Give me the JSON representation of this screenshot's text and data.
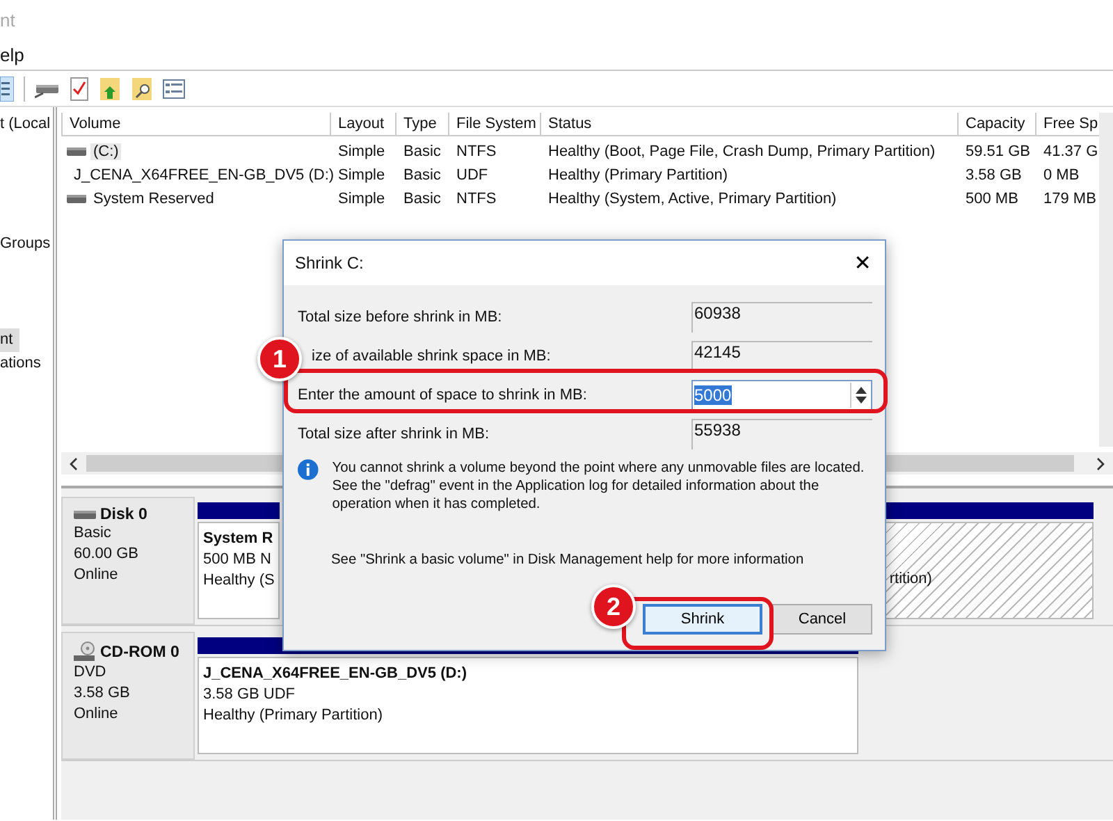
{
  "window": {
    "title": "nt"
  },
  "menu": [
    "elp"
  ],
  "tree": [
    {
      "label": "t (Local",
      "selected": false
    },
    {
      "label": "Groups",
      "selected": false
    },
    {
      "label": "nt",
      "selected": true
    },
    {
      "label": "ations",
      "selected": false
    }
  ],
  "volumes": {
    "columns": [
      "Volume",
      "Layout",
      "Type",
      "File System",
      "Status",
      "Capacity",
      "Free Sp"
    ],
    "rows": [
      {
        "kind": "disk",
        "selected": true,
        "cells": [
          "(C:)",
          "Simple",
          "Basic",
          "NTFS",
          "Healthy (Boot, Page File, Crash Dump, Primary Partition)",
          "59.51 GB",
          "41.37 G"
        ]
      },
      {
        "kind": "cdrom",
        "selected": false,
        "cells": [
          "J_CENA_X64FREE_EN-GB_DV5 (D:)",
          "Simple",
          "Basic",
          "UDF",
          "Healthy (Primary Partition)",
          "3.58 GB",
          "0 MB"
        ]
      },
      {
        "kind": "disk",
        "selected": false,
        "cells": [
          "System Reserved",
          "Simple",
          "Basic",
          "NTFS",
          "Healthy (System, Active, Primary Partition)",
          "500 MB",
          "179 MB"
        ]
      }
    ]
  },
  "disks": [
    {
      "kind": "disk",
      "name": "Disk 0",
      "lines": [
        "Basic",
        "60.00 GB",
        "Online"
      ],
      "partitions": [
        {
          "selected": false,
          "title": "System R",
          "lines": [
            "500 MB N",
            "Healthy (S"
          ]
        },
        {
          "selected": true,
          "lines": [
            "rtition)"
          ]
        }
      ]
    },
    {
      "kind": "cdrom",
      "name": "CD-ROM 0",
      "lines": [
        "DVD",
        "3.58 GB",
        "Online"
      ],
      "partitions": [
        {
          "selected": false,
          "title": "J_CENA_X64FREE_EN-GB_DV5  (D:)",
          "lines": [
            "3.58 GB UDF",
            "Healthy (Primary Partition)"
          ]
        }
      ]
    }
  ],
  "dialog": {
    "title": "Shrink C:",
    "close": "✕",
    "fields": [
      {
        "label": "Total size before shrink in MB:",
        "value": "60938",
        "kind": "readonly"
      },
      {
        "label": "ize of available shrink space in MB:",
        "value": "42145",
        "kind": "readonly"
      },
      {
        "label": "Enter the amount of space to shrink in MB:",
        "value": "5000",
        "kind": "spin"
      },
      {
        "label": "Total size after shrink in MB:",
        "value": "55938",
        "kind": "readonly"
      }
    ],
    "info": "You cannot shrink a volume beyond the point where any unmovable files are located. See the \"defrag\" event in the Application log for detailed information about the operation when it has completed.",
    "help": "See \"Shrink a basic volume\" in Disk Management help for more information",
    "buttons": [
      {
        "label": "Shrink",
        "default": true
      },
      {
        "label": "Cancel",
        "default": false
      }
    ]
  },
  "annotations": [
    {
      "number": "1"
    },
    {
      "number": "2"
    }
  ]
}
